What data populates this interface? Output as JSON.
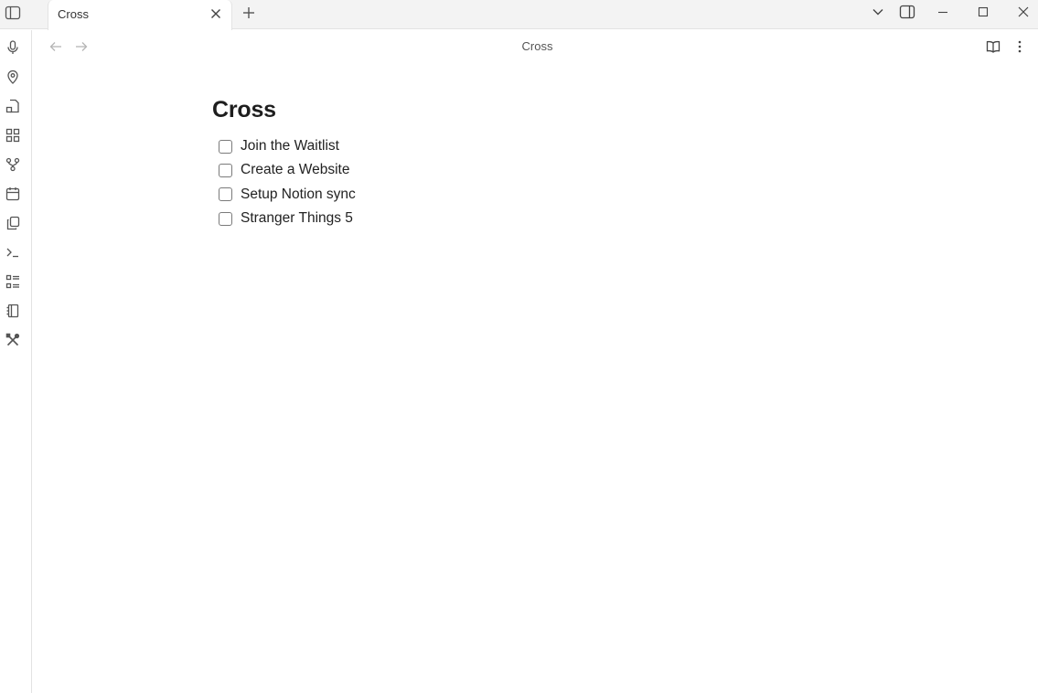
{
  "tabs": [
    {
      "label": "Cross",
      "active": true
    }
  ],
  "header": {
    "title": "Cross"
  },
  "ribbon": {
    "icons": [
      "microphone-icon",
      "map-pin-icon",
      "file-import-icon",
      "layout-dashboard-icon",
      "git-fork-icon",
      "calendar-icon",
      "copy-files-icon",
      "terminal-icon",
      "list-checks-icon",
      "notebook-icon",
      "tools-icon"
    ]
  },
  "note": {
    "title": "Cross",
    "tasks": [
      {
        "label": "Join the Waitlist",
        "checked": false
      },
      {
        "label": "Create a Website",
        "checked": false
      },
      {
        "label": "Setup Notion sync",
        "checked": false
      },
      {
        "label": "Stranger Things 5",
        "checked": false
      }
    ]
  },
  "colors": {
    "titlebar": "#f3f3f3",
    "border": "#e3e3e3",
    "text": "#222222",
    "icon": "#555555"
  }
}
